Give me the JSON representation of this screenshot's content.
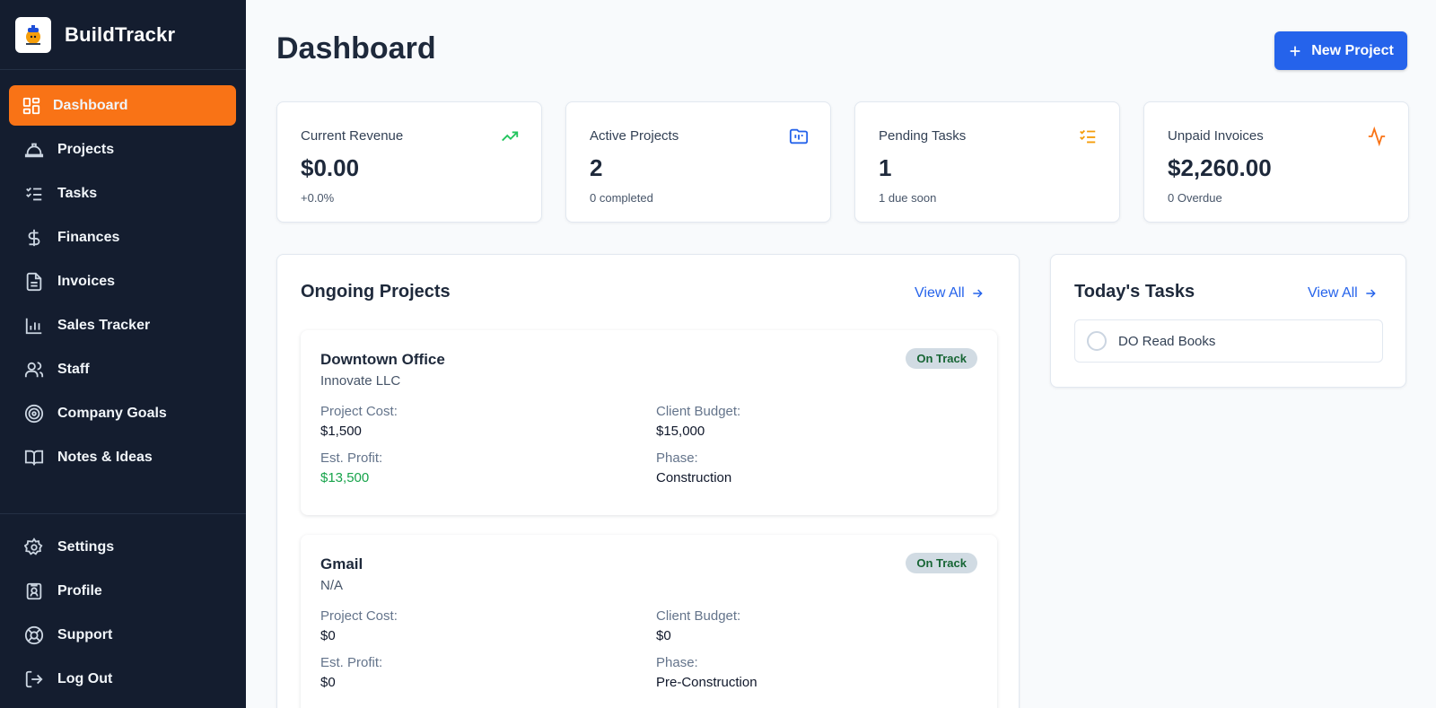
{
  "app": {
    "name": "BuildTrackr"
  },
  "sidebar": {
    "items": [
      {
        "label": "Dashboard",
        "icon": "layout-grid-icon",
        "active": true
      },
      {
        "label": "Projects",
        "icon": "hard-hat-icon"
      },
      {
        "label": "Tasks",
        "icon": "list-checks-icon"
      },
      {
        "label": "Finances",
        "icon": "dollar-sign-icon"
      },
      {
        "label": "Invoices",
        "icon": "file-text-icon"
      },
      {
        "label": "Sales Tracker",
        "icon": "bar-chart-icon"
      },
      {
        "label": "Staff",
        "icon": "users-icon"
      },
      {
        "label": "Company Goals",
        "icon": "target-icon"
      },
      {
        "label": "Notes & Ideas",
        "icon": "book-open-icon"
      }
    ],
    "bottom_items": [
      {
        "label": "Settings",
        "icon": "gear-icon"
      },
      {
        "label": "Profile",
        "icon": "id-badge-icon"
      },
      {
        "label": "Support",
        "icon": "life-buoy-icon"
      },
      {
        "label": "Log Out",
        "icon": "log-out-icon"
      }
    ]
  },
  "header": {
    "title": "Dashboard",
    "new_project_label": "New Project"
  },
  "stats": [
    {
      "label": "Current Revenue",
      "value": "$0.00",
      "sub": "+0.0%",
      "icon": "trending-up-icon",
      "color": "#22c55e"
    },
    {
      "label": "Active Projects",
      "value": "2",
      "sub": "0 completed",
      "icon": "folder-kanban-icon",
      "color": "#2563eb"
    },
    {
      "label": "Pending Tasks",
      "value": "1",
      "sub": "1 due soon",
      "icon": "list-checks-icon",
      "color": "#f59e0b"
    },
    {
      "label": "Unpaid Invoices",
      "value": "$2,260.00",
      "sub": "0 Overdue",
      "icon": "activity-icon",
      "color": "#f97316"
    }
  ],
  "ongoing": {
    "title": "Ongoing Projects",
    "view_all": "View All",
    "projects": [
      {
        "name": "Downtown Office",
        "client": "Innovate LLC",
        "status": "On Track",
        "cost_label": "Project Cost:",
        "cost": "$1,500",
        "budget_label": "Client Budget:",
        "budget": "$15,000",
        "profit_label": "Est. Profit:",
        "profit": "$13,500",
        "phase_label": "Phase:",
        "phase": "Construction"
      },
      {
        "name": "Gmail",
        "client": "N/A",
        "status": "On Track",
        "cost_label": "Project Cost:",
        "cost": "$0",
        "budget_label": "Client Budget:",
        "budget": "$0",
        "profit_label": "Est. Profit:",
        "profit": "$0",
        "phase_label": "Phase:",
        "phase": "Pre-Construction"
      }
    ]
  },
  "today": {
    "title": "Today's Tasks",
    "view_all": "View All",
    "tasks": [
      {
        "text": "DO Read Books"
      }
    ]
  },
  "colors": {
    "sidebar_bg": "#141d2f",
    "active": "#f97316",
    "primary": "#2563eb",
    "profit_positive": "#16a34a"
  }
}
